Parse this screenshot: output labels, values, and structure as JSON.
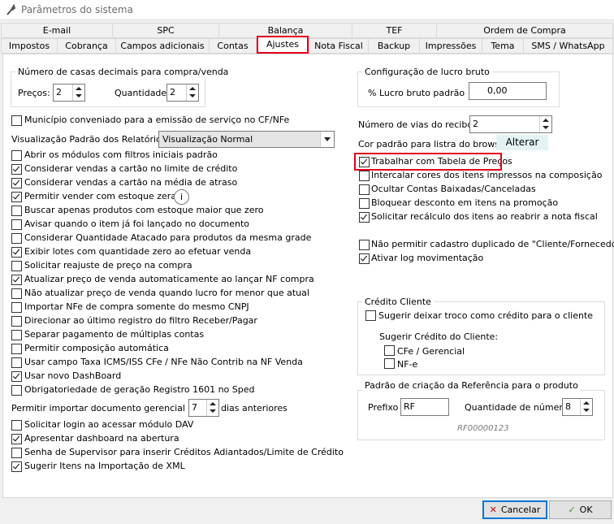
{
  "window": {
    "title": "Parâmetros do sistema"
  },
  "tabs_row1": [
    {
      "label": "E-mail"
    },
    {
      "label": "SPC"
    },
    {
      "label": "Balança"
    },
    {
      "label": "TEF"
    },
    {
      "label": "Ordem de Compra"
    }
  ],
  "tabs_row2": [
    {
      "label": "Impostos"
    },
    {
      "label": "Cobrança"
    },
    {
      "label": "Campos adicionais"
    },
    {
      "label": "Contas"
    },
    {
      "label": "Ajustes"
    },
    {
      "label": "Nota Fiscal"
    },
    {
      "label": "Backup"
    },
    {
      "label": "Impressões"
    },
    {
      "label": "Tema"
    },
    {
      "label": "SMS / WhatsApp"
    }
  ],
  "decimais": {
    "title": "Número de casas decimais para compra/venda",
    "precos_label": "Preços:",
    "precos_value": "2",
    "quantidade_label": "Quantidade:",
    "quantidade_value": "2"
  },
  "municipio": {
    "label": "Município conveniado para a emissão de serviço no CF/NFe",
    "checked": false
  },
  "relatorios": {
    "label": "Visualização Padrão dos Relatórios:",
    "value": "Visualização Normal"
  },
  "left_checks": [
    {
      "label": "Abrir os módulos com filtros iniciais padrão",
      "checked": false
    },
    {
      "label": "Considerar vendas a cartão no limite de crédito",
      "checked": true
    },
    {
      "label": "Considerar vendas a cartão na média de atraso",
      "checked": true
    },
    {
      "label": "Permitir vender com estoque zerado",
      "checked": true
    },
    {
      "label": "Buscar apenas produtos com estoque maior que zero",
      "checked": false
    },
    {
      "label": "Avisar quando o item já foi lançado no documento",
      "checked": false
    },
    {
      "label": "Considerar Quantidade Atacado para produtos da mesma grade",
      "checked": false
    },
    {
      "label": "Exibir lotes com quantidade zero ao efetuar venda",
      "checked": true
    },
    {
      "label": "Solicitar reajuste de preço na compra",
      "checked": false
    },
    {
      "label": "Atualizar preço de venda automaticamente ao lançar NF compra",
      "checked": true
    },
    {
      "label": "Não atualizar preço de venda quando lucro for menor que atual",
      "checked": false
    },
    {
      "label": "Importar NFe de compra somente do mesmo CNPJ",
      "checked": false
    },
    {
      "label": "Direcionar ao último registro do filtro Receber/Pagar",
      "checked": false
    },
    {
      "label": "Separar pagamento de múltiplas contas",
      "checked": false
    },
    {
      "label": "Permitir composição automática",
      "checked": false
    },
    {
      "label": "Usar campo Taxa ICMS/ISS CFe / NFe Não Contrib na NF Venda",
      "checked": false
    },
    {
      "label": "Usar novo DashBoard",
      "checked": true
    },
    {
      "label": "Obrigatoriedade de geração Registro 1601 no Sped",
      "checked": false
    }
  ],
  "importar": {
    "label_before": "Permitir importar documento gerencial de até",
    "value": "7",
    "label_after": "dias anteriores"
  },
  "left_checks2": [
    {
      "label": "Solicitar login ao acessar módulo DAV",
      "checked": false
    },
    {
      "label": "Apresentar dashboard na abertura",
      "checked": true
    },
    {
      "label": "Senha de Supervisor para inserir Créditos Adiantados/Limite de Crédito",
      "checked": false
    },
    {
      "label": "Sugerir Itens na Importação de XML",
      "checked": true
    }
  ],
  "lucro": {
    "title": "Configuração de lucro bruto",
    "label": "% Lucro bruto padrão",
    "value": "0,00"
  },
  "vias": {
    "label": "Número de vias do recibo:",
    "value": "2"
  },
  "browse": {
    "label": "Cor padrão para listra do browse:",
    "button": "Alterar"
  },
  "right_checks": [
    {
      "label": "Trabalhar com Tabela de Preços",
      "checked": true
    },
    {
      "label": "Intercalar cores dos itens impressos na composição",
      "checked": false
    },
    {
      "label": "Ocultar Contas Baixadas/Canceladas",
      "checked": false
    },
    {
      "label": "Bloquear desconto em itens na promoção",
      "checked": false
    },
    {
      "label": "Solicitar recálculo dos itens ao reabrir a nota fiscal",
      "checked": true
    }
  ],
  "right_checks2": [
    {
      "label": "Não permitir cadastro duplicado de \"Cliente/Fornecedores\"",
      "checked": false
    },
    {
      "label": "Ativar log movimentação",
      "checked": true
    }
  ],
  "credito": {
    "title": "Crédito Cliente",
    "troco_label": "Sugerir deixar troco como crédito para o cliente",
    "troco_checked": false,
    "sugerir_label": "Sugerir Crédito do Cliente:",
    "cfe_label": "CFe / Gerencial",
    "cfe_checked": false,
    "nfe_label": "NF-e",
    "nfe_checked": false
  },
  "referencia": {
    "title": "Padrão de criação da Referência para o produto",
    "prefixo_label": "Prefixo",
    "prefixo_value": "RF",
    "qtd_label": "Quantidade de números",
    "qtd_value": "8",
    "exemplo": "RF00000123"
  },
  "buttons": {
    "cancelar": "Cancelar",
    "ok": "OK"
  },
  "colors": {
    "highlight": "#e0001b",
    "panel": "#ffffff",
    "window": "#f0f0f0"
  }
}
